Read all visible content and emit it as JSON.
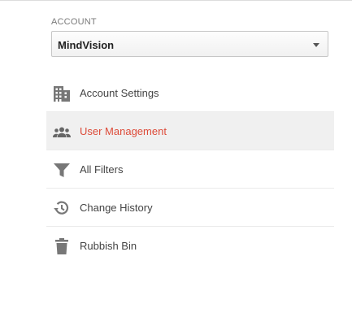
{
  "account": {
    "label": "ACCOUNT",
    "selected": "MindVision",
    "dropdown_icon": "caret-down-icon"
  },
  "nav": {
    "items": [
      {
        "label": "Account Settings",
        "icon": "building-icon",
        "selected": false
      },
      {
        "label": "User Management",
        "icon": "users-icon",
        "selected": true
      },
      {
        "label": "All Filters",
        "icon": "filter-icon",
        "selected": false
      },
      {
        "label": "Change History",
        "icon": "history-icon",
        "selected": false
      },
      {
        "label": "Rubbish Bin",
        "icon": "trash-icon",
        "selected": false
      }
    ]
  },
  "colors": {
    "selected_text": "#dd4b39",
    "selected_background": "#f0f0f0",
    "icon": "#777777",
    "label": "#444444"
  }
}
